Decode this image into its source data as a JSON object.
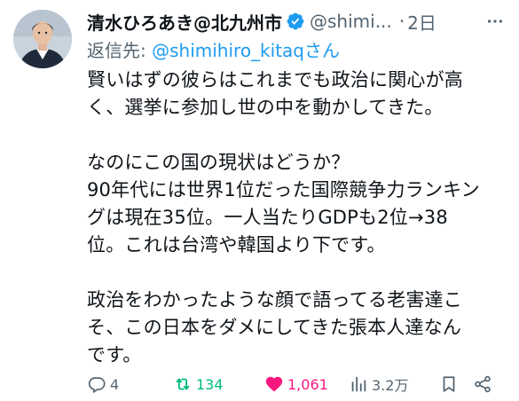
{
  "tweet": {
    "author_name": "清水ひろあき@北九州市",
    "handle": "@shimi...",
    "separator": "·",
    "time": "2日",
    "reply_to_label": "返信先: ",
    "reply_to_handle": "@shimihiro_kitaq",
    "reply_to_suffix": "さん",
    "paragraphs": [
      [
        "賢いはずの彼らはこれまでも政治に関心が高",
        "く、選挙に参加し世の中を動かしてきた。"
      ],
      [
        "なのにこの国の現状はどうか？",
        "90年代には世界1位だった国際競争力ランキン",
        "グは現在35位。一人当たりGDPも2位→38",
        "位。これは台湾や韓国より下です。"
      ],
      [
        "政治をわかったような顔で語ってる老害達こ",
        "そ、この日本をダメにしてきた張本人達なん",
        "です。"
      ]
    ],
    "actions": {
      "reply_count": "4",
      "retweet_count": "134",
      "like_count": "1,061",
      "view_count": "3.2万"
    }
  },
  "colors": {
    "text": "#0f1419",
    "secondary": "#536471",
    "link": "#1d9bf0",
    "retweet_active": "#00ba7c",
    "like_active": "#f91880",
    "verified": "#1d9bf0"
  },
  "icons": {
    "verified": "verified-badge-icon",
    "more": "more-options-icon",
    "reply": "reply-icon",
    "retweet": "retweet-icon",
    "like": "heart-icon",
    "views": "views-icon",
    "bookmark": "bookmark-icon",
    "share": "share-icon"
  }
}
